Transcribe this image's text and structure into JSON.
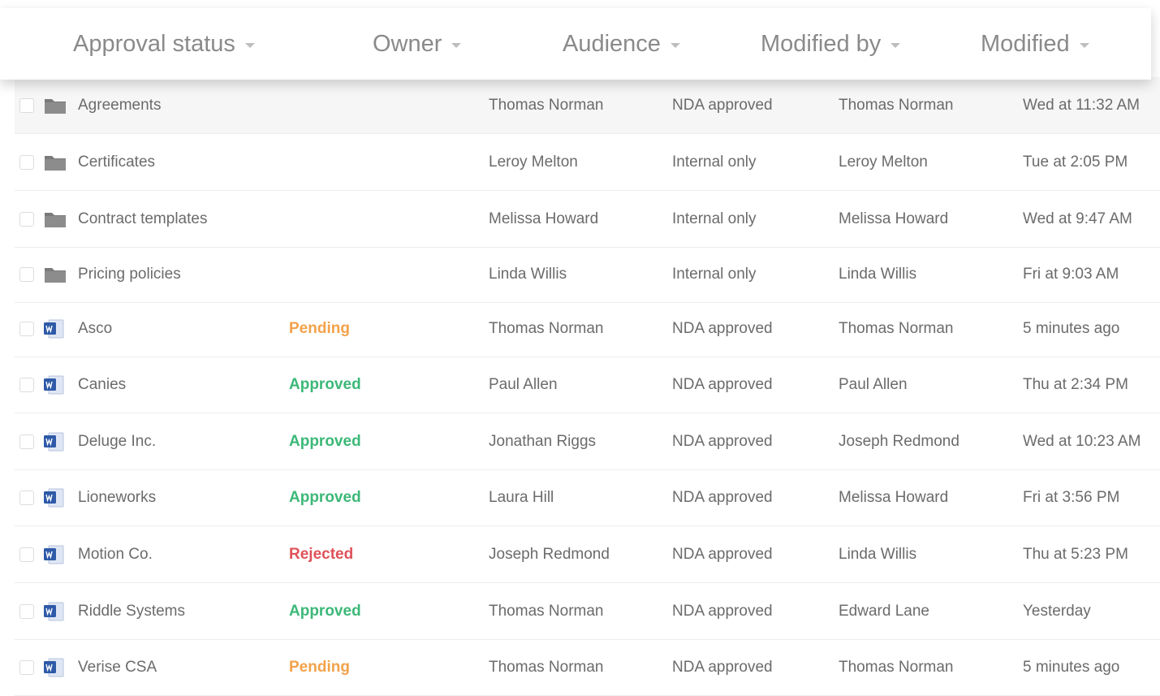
{
  "colors": {
    "pending": "#f2a24a",
    "approved": "#3cb878",
    "rejected": "#e0525a",
    "folder": "#7a7a7a",
    "word": "#2e5aa8"
  },
  "header": {
    "columns": [
      {
        "label": "Approval status"
      },
      {
        "label": "Owner"
      },
      {
        "label": "Audience"
      },
      {
        "label": "Modified by"
      },
      {
        "label": "Modified"
      }
    ]
  },
  "rows": [
    {
      "type": "folder",
      "icon": "folder-icon",
      "name": "Agreements",
      "status": "",
      "status_kind": "",
      "owner": "Thomas Norman",
      "audience": "NDA approved",
      "modified_by": "Thomas Norman",
      "modified": "Wed at 11:32 AM"
    },
    {
      "type": "folder",
      "icon": "folder-icon",
      "name": "Certificates",
      "status": "",
      "status_kind": "",
      "owner": "Leroy Melton",
      "audience": "Internal only",
      "modified_by": "Leroy Melton",
      "modified": "Tue at 2:05 PM"
    },
    {
      "type": "folder",
      "icon": "folder-icon",
      "name": "Contract templates",
      "status": "",
      "status_kind": "",
      "owner": "Melissa Howard",
      "audience": "Internal only",
      "modified_by": "Melissa Howard",
      "modified": "Wed at 9:47 AM"
    },
    {
      "type": "folder",
      "icon": "folder-icon",
      "name": "Pricing policies",
      "status": "",
      "status_kind": "",
      "owner": "Linda Willis",
      "audience": "Internal only",
      "modified_by": "Linda Willis",
      "modified": "Fri at 9:03 AM"
    },
    {
      "type": "doc",
      "icon": "word-document-icon",
      "name": "Asco",
      "status": "Pending",
      "status_kind": "pending",
      "owner": "Thomas Norman",
      "audience": "NDA approved",
      "modified_by": "Thomas Norman",
      "modified": "5 minutes ago"
    },
    {
      "type": "doc",
      "icon": "word-document-icon",
      "name": "Canies",
      "status": "Approved",
      "status_kind": "approved",
      "owner": "Paul Allen",
      "audience": "NDA approved",
      "modified_by": "Paul Allen",
      "modified": "Thu at 2:34 PM"
    },
    {
      "type": "doc",
      "icon": "word-document-icon",
      "name": "Deluge Inc.",
      "status": "Approved",
      "status_kind": "approved",
      "owner": "Jonathan Riggs",
      "audience": "NDA approved",
      "modified_by": "Joseph Redmond",
      "modified": "Wed at 10:23 AM"
    },
    {
      "type": "doc",
      "icon": "word-document-icon",
      "name": "Lioneworks",
      "status": "Approved",
      "status_kind": "approved",
      "owner": "Laura Hill",
      "audience": "NDA approved",
      "modified_by": "Melissa Howard",
      "modified": "Fri at 3:56 PM"
    },
    {
      "type": "doc",
      "icon": "word-document-icon",
      "name": "Motion Co.",
      "status": "Rejected",
      "status_kind": "rejected",
      "owner": "Joseph Redmond",
      "audience": "NDA approved",
      "modified_by": "Linda Willis",
      "modified": "Thu at 5:23 PM"
    },
    {
      "type": "doc",
      "icon": "word-document-icon",
      "name": "Riddle Systems",
      "status": "Approved",
      "status_kind": "approved",
      "owner": "Thomas Norman",
      "audience": "NDA approved",
      "modified_by": "Edward Lane",
      "modified": "Yesterday"
    },
    {
      "type": "doc",
      "icon": "word-document-icon",
      "name": "Verise CSA",
      "status": "Pending",
      "status_kind": "pending",
      "owner": "Thomas Norman",
      "audience": "NDA approved",
      "modified_by": "Thomas Norman",
      "modified": "5 minutes ago"
    }
  ]
}
